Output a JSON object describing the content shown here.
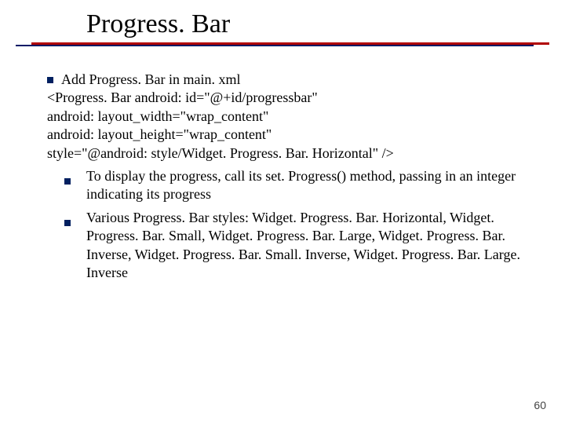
{
  "title": "Progress. Bar",
  "intro_bullet": "Add Progress. Bar in main. xml",
  "code_lines": [
    "<Progress. Bar android: id=\"@+id/progressbar\"",
    "android: layout_width=\"wrap_content\"",
    "android: layout_height=\"wrap_content\"",
    "style=\"@android: style/Widget. Progress. Bar. Horizontal\" />"
  ],
  "sub_bullets": [
    "To display the progress, call its set. Progress() method, passing in an integer indicating its progress",
    "Various Progress. Bar styles: Widget. Progress. Bar. Horizontal, Widget. Progress. Bar. Small, Widget. Progress. Bar. Large, Widget. Progress. Bar. Inverse, Widget. Progress. Bar. Small. Inverse, Widget. Progress. Bar. Large. Inverse"
  ],
  "page_number": "60"
}
